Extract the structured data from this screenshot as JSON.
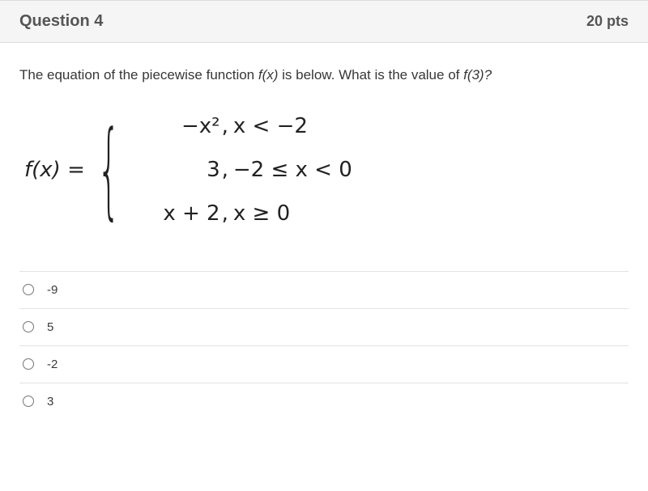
{
  "header": {
    "title": "Question 4",
    "points": "20 pts"
  },
  "prompt": {
    "lead": "The equation of the piecewise function ",
    "fx": "f(x)",
    "mid": " is below. What is the value of ",
    "fof": "f(3)?"
  },
  "piecewise": {
    "lhs": "f(x) =",
    "cases": [
      {
        "expr": "−x²",
        "comma": ",",
        "cond": "x < −2"
      },
      {
        "expr": "3",
        "comma": ",",
        "cond": "−2 ≤ x < 0"
      },
      {
        "expr": "x + 2",
        "comma": ",",
        "cond": "x ≥ 0"
      }
    ]
  },
  "choices": [
    {
      "label": "-9"
    },
    {
      "label": "5"
    },
    {
      "label": "-2"
    },
    {
      "label": "3"
    }
  ]
}
